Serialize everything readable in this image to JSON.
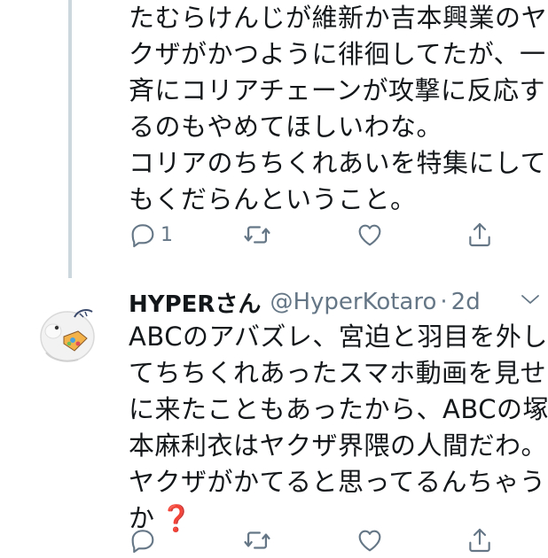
{
  "tweet1": {
    "lines": [
      "たむらけんじが維新か吉本興業のヤ",
      "クザがかつように徘徊してたが、一",
      "斉にコリアチェーンが攻撃に反応す",
      "るのもやめてほしいわな。",
      "コリアのちちくれあいを特集にして",
      "もくだらんということ。"
    ],
    "reply_count": "1"
  },
  "tweet2": {
    "display_name": "HYPERさん",
    "handle": "@HyperKotaro",
    "separator": "·",
    "time": "2d",
    "lines": [
      "ABCのアバズレ、宮迫と羽目を外し",
      "てちちくれあったスマホ動画を見せ",
      "に来たこともあったから、ABCの塚",
      "本麻利衣はヤクザ界隈の人間だわ。",
      "ヤクザがかてると思ってるんちゃう",
      "か"
    ],
    "emoji": "❓"
  },
  "colors": {
    "icon_gray": "#657786",
    "thread_line": "#ccd6dd",
    "text": "#14171a",
    "question_red": "#dd2e44"
  },
  "icons": {
    "reply": "reply-icon",
    "retweet": "retweet-icon",
    "like": "heart-icon",
    "share": "share-icon",
    "chevron": "chevron-down-icon",
    "avatar": "avatar"
  }
}
